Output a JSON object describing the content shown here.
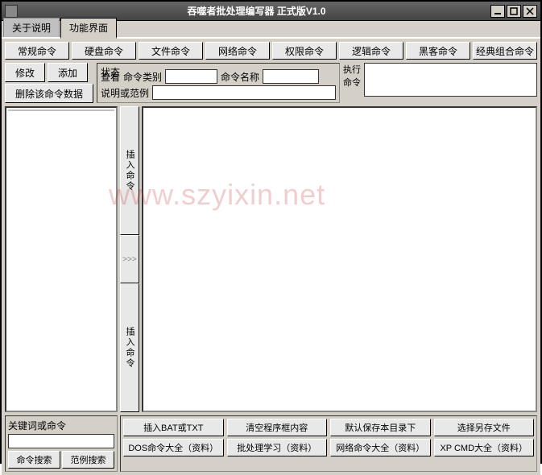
{
  "window": {
    "title": "吞噬者批处理编写器 正式版V1.0"
  },
  "tabs": {
    "about": "关于说明",
    "func": "功能界面"
  },
  "categories": [
    "常规命令",
    "硬盘命令",
    "文件命令",
    "网络命令",
    "权限命令",
    "逻辑命令",
    "黑客命令",
    "经典组合命令"
  ],
  "actions": {
    "modify": "修改",
    "add": "添加",
    "delete": "删除该命令数据"
  },
  "status": {
    "label": "状态",
    "view": "查看",
    "cmd_type_label": "命令类别",
    "cmd_type": "",
    "cmd_name_label": "命令名称",
    "cmd_name": "",
    "desc_label": "说明或范例",
    "desc": "",
    "exec_label_l1": "执行",
    "exec_label_l2": "命令"
  },
  "tree": {
    "items": [
      "",
      ""
    ]
  },
  "insert": {
    "top": "插入命令",
    "mid": ">>>",
    "bot": "插入命令"
  },
  "keyword": {
    "label": "关键词或命令",
    "value": "",
    "search_cmd": "命令搜索",
    "search_example": "范例搜索"
  },
  "bottom_buttons": {
    "row1": [
      "插入BAT或TXT",
      "清空程序框内容",
      "默认保存本目录下",
      "选择另存文件"
    ],
    "row2": [
      "DOS命令大全（资料）",
      "批处理学习（资料）",
      "网络命令大全（资料）",
      "XP CMD大全（资料）"
    ]
  },
  "watermark": "www.szyixin.net"
}
